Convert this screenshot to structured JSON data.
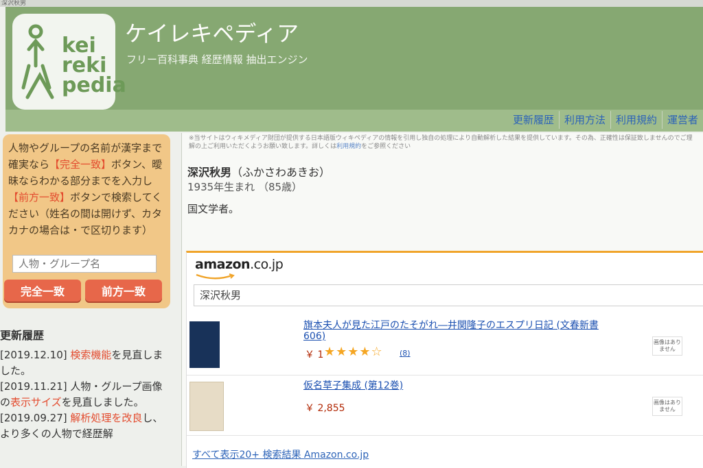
{
  "window": {
    "strip_text": "深沢秋男"
  },
  "header": {
    "logo_lines": [
      "kei",
      "reki",
      "pedia"
    ],
    "title": "ケイレキペディア",
    "subtitle": "フリー百科事典 経歴情報 抽出エンジン",
    "nav": [
      "更新履歴",
      "利用方法",
      "利用規約",
      "運営者"
    ]
  },
  "search_panel": {
    "instructions_pre": "人物やグループの名前が漢字まで確実なら",
    "exact_token": "【完全一致】",
    "instructions_mid": "ボタン、曖昧ならわかる部分までを入力し",
    "prefix_token": "【前方一致】",
    "instructions_post": "ボタンで検索してください（姓名の間は開けず、カタカナの場合は・で区切ります）",
    "input_placeholder": "人物・グループ名",
    "exact_button": "完全一致",
    "prefix_button": "前方一致"
  },
  "updates": {
    "heading": "更新履歴",
    "entries": [
      {
        "date": "[2019.12.10]",
        "link": "検索機能",
        "text": "を見直しました。"
      },
      {
        "date": "[2019.11.21]",
        "pre": "人物・グループ画像の",
        "link": "表示サイズ",
        "text": "を見直しました。"
      },
      {
        "date": "[2019.09.27]",
        "link": "解析処理を改良",
        "text": "し、より多くの人物で経歴解"
      }
    ]
  },
  "notice": {
    "text": "※当サイトはウィキメディア財団が提供する日本語版ウィキペディアの情報を引用し独自の処理により自動解析した結果を提供しています。その為、正確性は保証致しませんのでご理解の上ご利用いただくようお願い致します。詳しくは",
    "link": "利用規約",
    "suffix": "をご参照ください"
  },
  "person": {
    "name": "深沢秋男",
    "reading": "（ふかさわあきお）",
    "born": "1935年生まれ （85歳）",
    "description": "国文学者。"
  },
  "amazon": {
    "logo_main": "amazon",
    "logo_suffix": ".co.jp",
    "query": "深沢秋男",
    "products": [
      {
        "title": "旗本夫人が見た江戸のたそがれ―井関隆子のエスプリ日記 (文春新書 606)",
        "price": "￥ 1",
        "rating": 4.5,
        "stars": "★★★★☆",
        "reviews": "(8)",
        "no_image": "画像はありません"
      },
      {
        "title": "仮名草子集成 (第12巻)",
        "price": "￥ 2,855",
        "no_image": "画像はありません"
      }
    ],
    "footer": "すべて表示20+ 検索結果 Amazon.co.jp"
  },
  "colors": {
    "header_green": "#86a872",
    "panel_orange": "#f1c787",
    "button_red": "#e7674a",
    "link_blue": "#2c63b8",
    "amazon_orange": "#f0a42a",
    "price_red": "#b12704"
  }
}
